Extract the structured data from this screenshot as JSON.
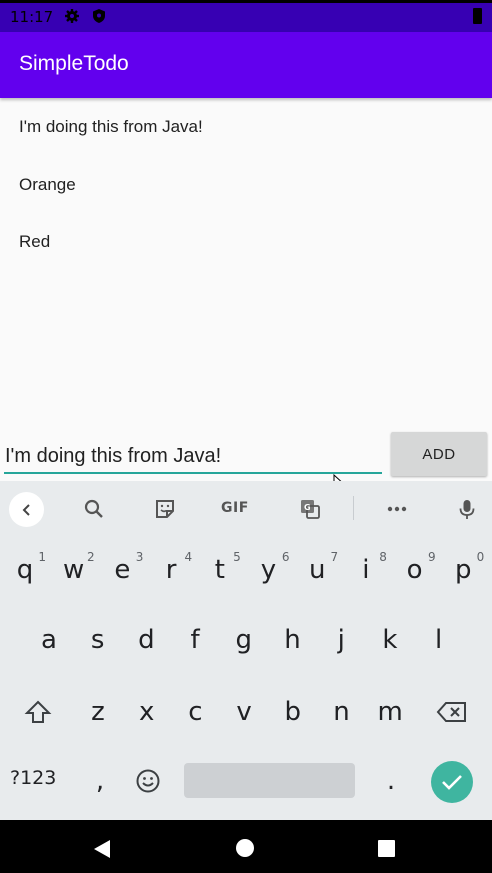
{
  "status_bar": {
    "time": "11:17",
    "icons": [
      "gear-icon",
      "shield-icon",
      "battery-icon"
    ]
  },
  "app_bar": {
    "title": "SimpleTodo",
    "color": "#6200ee",
    "status_color": "#3700b3"
  },
  "todo_items": [
    "I'm doing this from Java!",
    "Orange",
    "Red"
  ],
  "input": {
    "value": "I'm doing this from Java!",
    "accent": "#26a69a"
  },
  "add_button": {
    "label": "ADD"
  },
  "keyboard": {
    "toolbar_icons": [
      "chevron-left-icon",
      "search-icon",
      "sticker-icon",
      "gif-icon",
      "translate-icon",
      "more-icon",
      "microphone-icon"
    ],
    "gif_label": "GIF",
    "row1": [
      "q",
      "w",
      "e",
      "r",
      "t",
      "y",
      "u",
      "i",
      "o",
      "p"
    ],
    "row1_hints": [
      "1",
      "2",
      "3",
      "4",
      "5",
      "6",
      "7",
      "8",
      "9",
      "0"
    ],
    "row2": [
      "a",
      "s",
      "d",
      "f",
      "g",
      "h",
      "j",
      "k",
      "l"
    ],
    "row3": [
      "z",
      "x",
      "c",
      "v",
      "b",
      "n",
      "m"
    ],
    "symbols_label": "?123",
    "comma": ",",
    "period": ".",
    "enter_color": "#3fb5a0"
  },
  "nav_bar": {
    "icons": [
      "back-icon",
      "home-icon",
      "recents-icon"
    ]
  }
}
